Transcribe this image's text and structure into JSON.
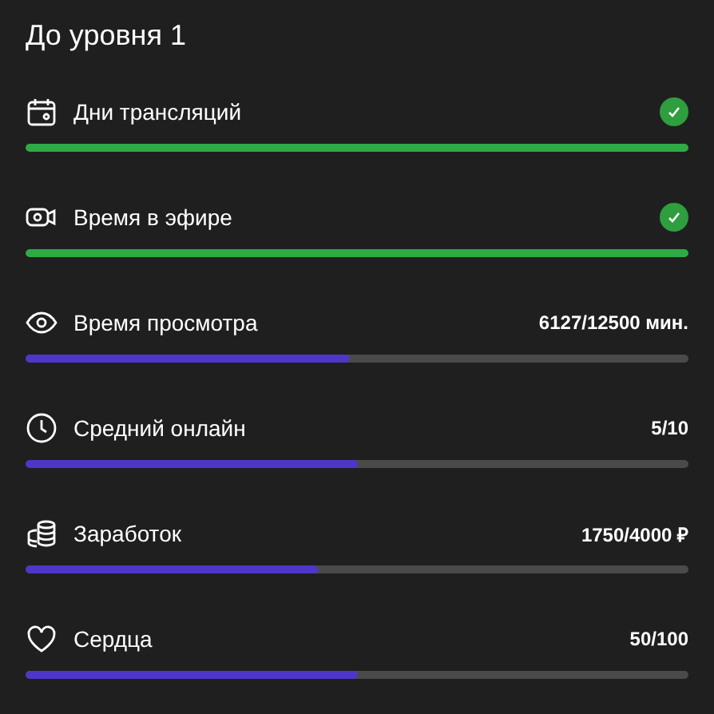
{
  "title": "До уровня 1",
  "items": [
    {
      "label": "Дни трансляций",
      "kind": "done",
      "level": 1
    },
    {
      "label": "Время в эфире",
      "kind": "done",
      "level": 1
    },
    {
      "label": "Время просмотра",
      "kind": "progress",
      "value": "6127/12500 мин.",
      "level": 0.49
    },
    {
      "label": "Средний онлайн",
      "kind": "progress",
      "value": "5/10",
      "level": 0.5
    },
    {
      "label": "Заработок",
      "kind": "progress",
      "value": "1750/4000 ₽",
      "level": 0.44
    },
    {
      "label": "Сердца",
      "kind": "progress",
      "value": "50/100",
      "level": 0.5
    }
  ]
}
